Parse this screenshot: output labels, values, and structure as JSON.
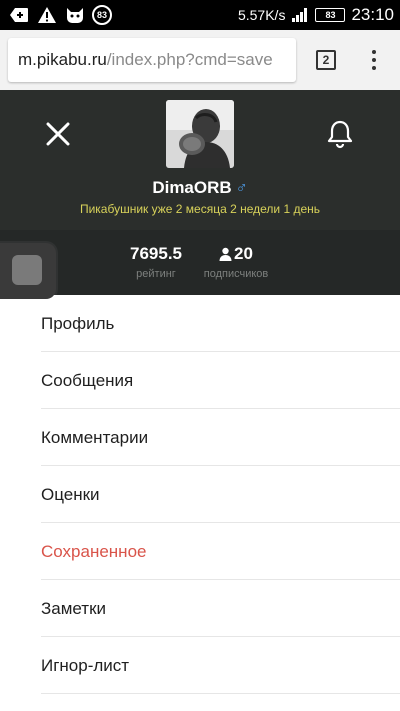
{
  "status_bar": {
    "speed": "5.57K/s",
    "battery": "83",
    "notif_count": "83",
    "time": "23:10"
  },
  "browser": {
    "url_host": "m.pikabu.ru",
    "url_path": "/index.php?cmd=save",
    "tab_count": "2"
  },
  "profile": {
    "username": "DimaORB",
    "gender_symbol": "♂",
    "since": "Пикабушник уже 2 месяца 2 недели 1 день",
    "rating_value": "7695.5",
    "rating_label": "рейтинг",
    "subscribers_value": "20",
    "subscribers_label": "подписчиков"
  },
  "menu": {
    "items": [
      {
        "label": "Профиль"
      },
      {
        "label": "Сообщения"
      },
      {
        "label": "Комментарии"
      },
      {
        "label": "Оценки"
      },
      {
        "label": "Сохраненное"
      },
      {
        "label": "Заметки"
      },
      {
        "label": "Игнор-лист"
      }
    ],
    "active_index": 4
  },
  "colors": {
    "header_bg": "#2b2e2c",
    "stats_bg": "#252827",
    "accent": "#d9544a",
    "since_text": "#d8d25a",
    "gender": "#4d9be6"
  }
}
